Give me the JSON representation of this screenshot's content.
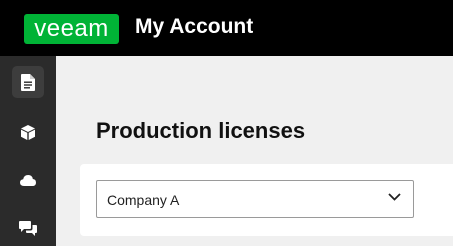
{
  "header": {
    "logo_text": "veeam",
    "title": "My Account"
  },
  "colors": {
    "brand_green": "#00b336",
    "topbar": "#000000",
    "sidebar": "#2b2b2b",
    "background": "#f0f0f0"
  },
  "sidebar": {
    "items": [
      {
        "icon": "document-icon",
        "active": true
      },
      {
        "icon": "box-icon",
        "active": false
      },
      {
        "icon": "cloud-icon",
        "active": false
      },
      {
        "icon": "chat-icon",
        "active": false
      }
    ]
  },
  "main": {
    "page_title": "Production licenses",
    "company_select": {
      "value": "Company A"
    }
  }
}
